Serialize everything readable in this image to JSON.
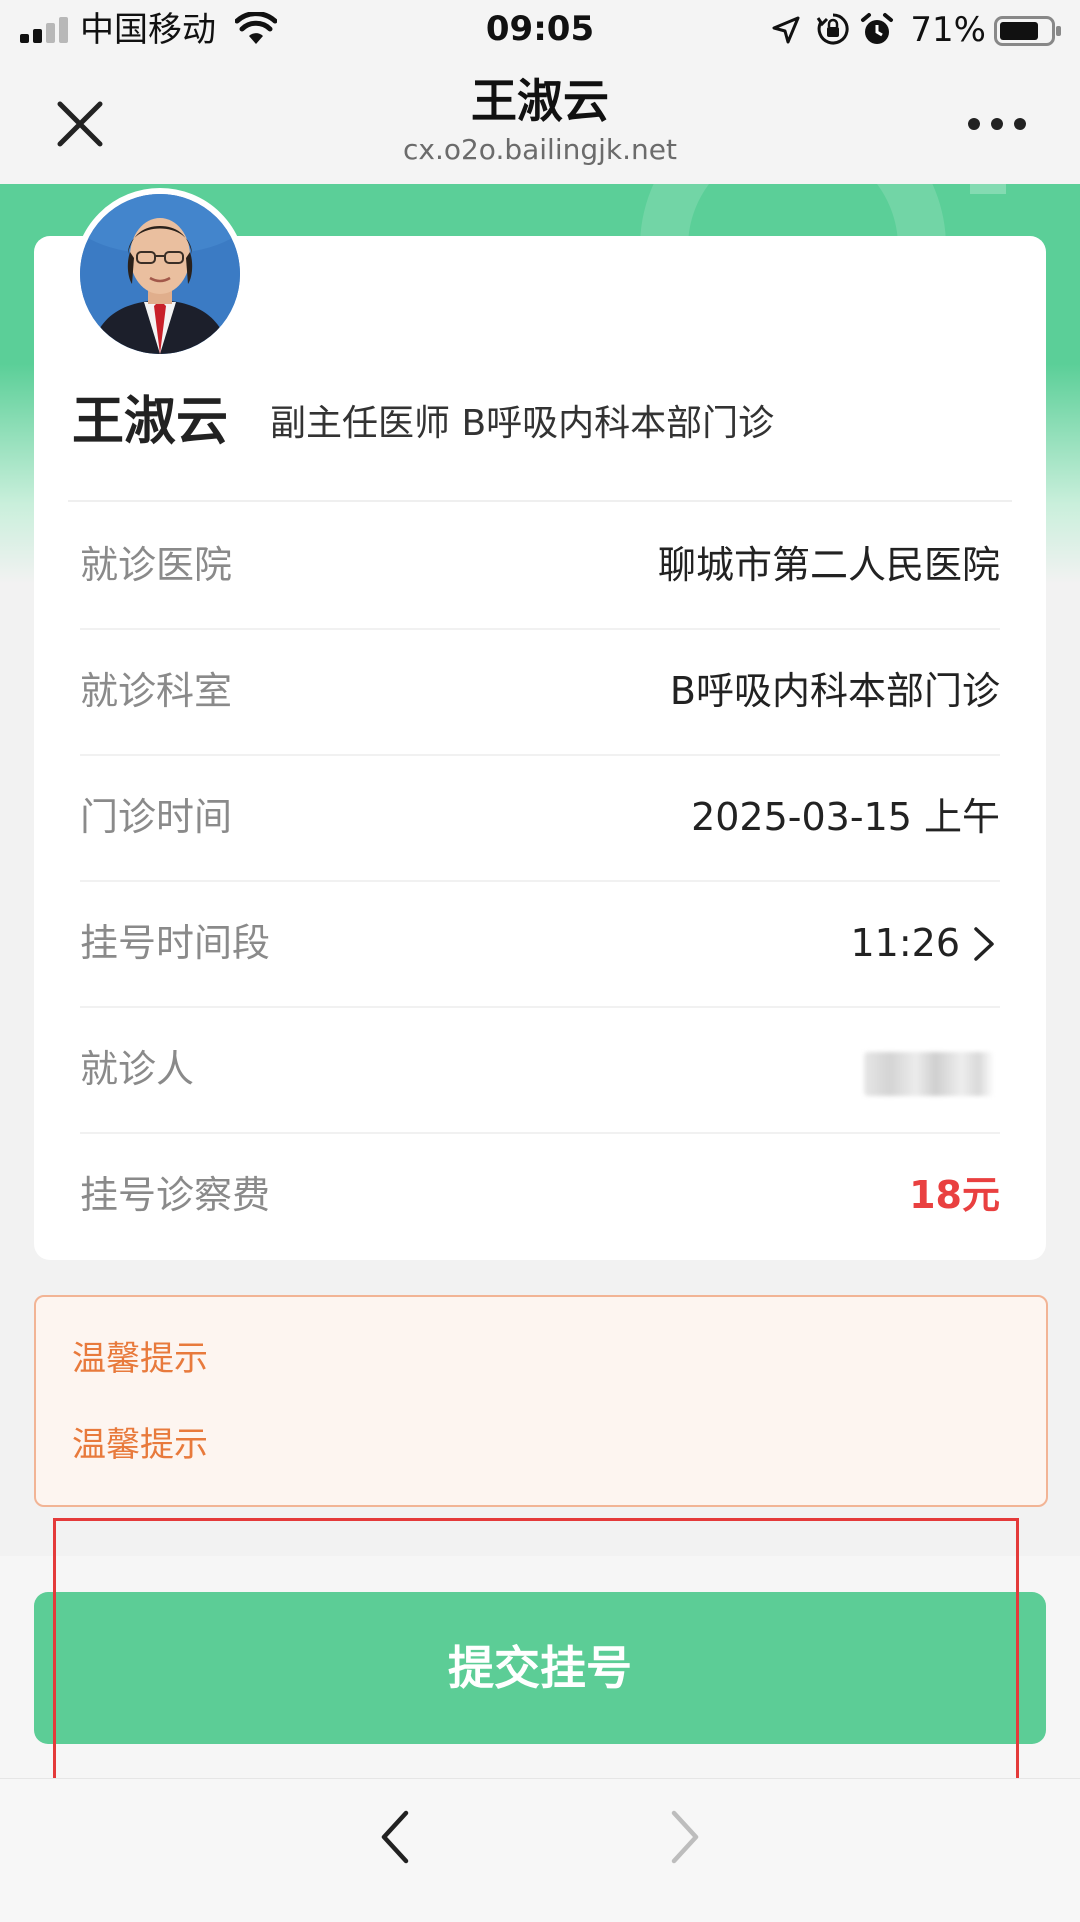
{
  "status_bar": {
    "carrier": "中国移动",
    "time": "09:05",
    "battery": "71%",
    "icons": [
      "signal-icon",
      "wifi-icon",
      "location-arrow-icon",
      "rotation-lock-icon",
      "alarm-icon",
      "battery-icon"
    ]
  },
  "header": {
    "title": "王淑云",
    "url": "cx.o2o.bailingjk.net",
    "icons": [
      "close-icon",
      "more-icon"
    ]
  },
  "doctor": {
    "name": "王淑云",
    "title": "副主任医师 B呼吸内科本部门诊"
  },
  "info": {
    "hospital": {
      "label": "就诊医院",
      "value": "聊城市第二人民医院"
    },
    "department": {
      "label": "就诊科室",
      "value": "B呼吸内科本部门诊"
    },
    "clinic_time": {
      "label": "门诊时间",
      "value": "2025-03-15 上午"
    },
    "slot": {
      "label": "挂号时间段",
      "value": "11:26"
    },
    "patient": {
      "label": "就诊人",
      "value": ""
    },
    "fee": {
      "label": "挂号诊察费",
      "value": "18元"
    }
  },
  "notice": {
    "lines": [
      "温馨提示",
      "温馨提示"
    ]
  },
  "submit": {
    "label": "提交挂号"
  },
  "colors": {
    "brand_green": "#5ccd96",
    "fee_red": "#e94040",
    "notice_orange": "#e87a3c",
    "highlight_red": "#e43a3a"
  },
  "toolbar": {
    "icons": [
      "back-chevron-icon",
      "forward-chevron-icon"
    ]
  }
}
